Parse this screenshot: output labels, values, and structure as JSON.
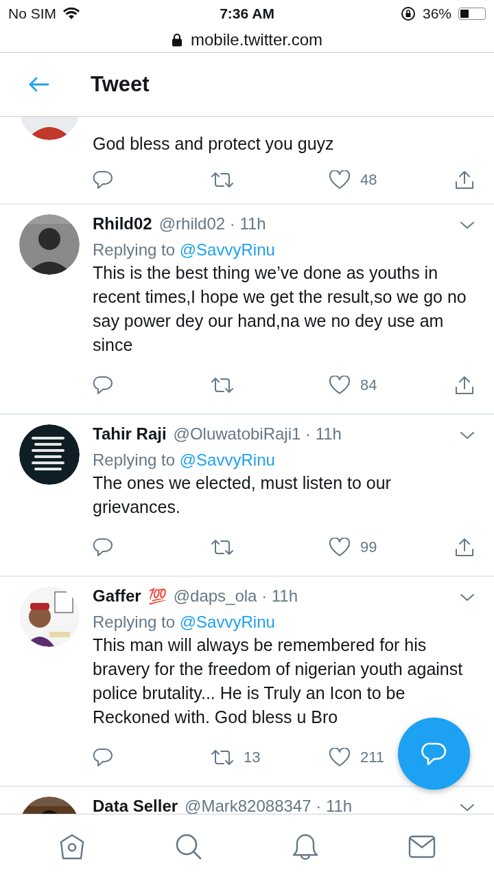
{
  "status_bar": {
    "carrier": "No SIM",
    "time": "7:36 AM",
    "battery": "36%"
  },
  "address_bar": {
    "url": "mobile.twitter.com"
  },
  "header": {
    "title": "Tweet"
  },
  "tweets": [
    {
      "text": "God bless and protect you guyz",
      "actions": {
        "likes": "48",
        "share": true
      }
    },
    {
      "name": "Rhild02",
      "meta": "@rhild02 · 11h",
      "replying": {
        "prefix": "Replying to",
        "mention": "@SavvyRinu"
      },
      "text": "This is the best thing we’ve done as youths in recent times,I hope we get the result,so we go no say power dey our hand,na we no dey use am since",
      "actions": {
        "likes": "84",
        "share": true
      }
    },
    {
      "name": "Tahir Raji",
      "meta": "@OluwatobiRaji1 · 11h",
      "replying": {
        "prefix": "Replying to",
        "mention": "@SavvyRinu"
      },
      "text": "The ones we elected, must listen to our grievances.",
      "actions": {
        "likes": "99",
        "share": true
      }
    },
    {
      "name": "Gaffer",
      "badge": "💯",
      "meta": "@daps_ola · 11h",
      "replying": {
        "prefix": "Replying to",
        "mention": "@SavvyRinu"
      },
      "text": "This man will always be remembered for his bravery for the freedom of nigerian youth against police brutality... He is Truly an Icon to be Reckoned with. God bless u Bro",
      "actions": {
        "retweets": "13",
        "likes": "211",
        "share": false
      }
    },
    {
      "name": "Data Seller",
      "meta": "@Mark82088347 · 11h"
    }
  ],
  "nav": [
    {
      "kind": "home"
    },
    {
      "kind": "search"
    },
    {
      "kind": "notifications"
    },
    {
      "kind": "messages"
    }
  ]
}
